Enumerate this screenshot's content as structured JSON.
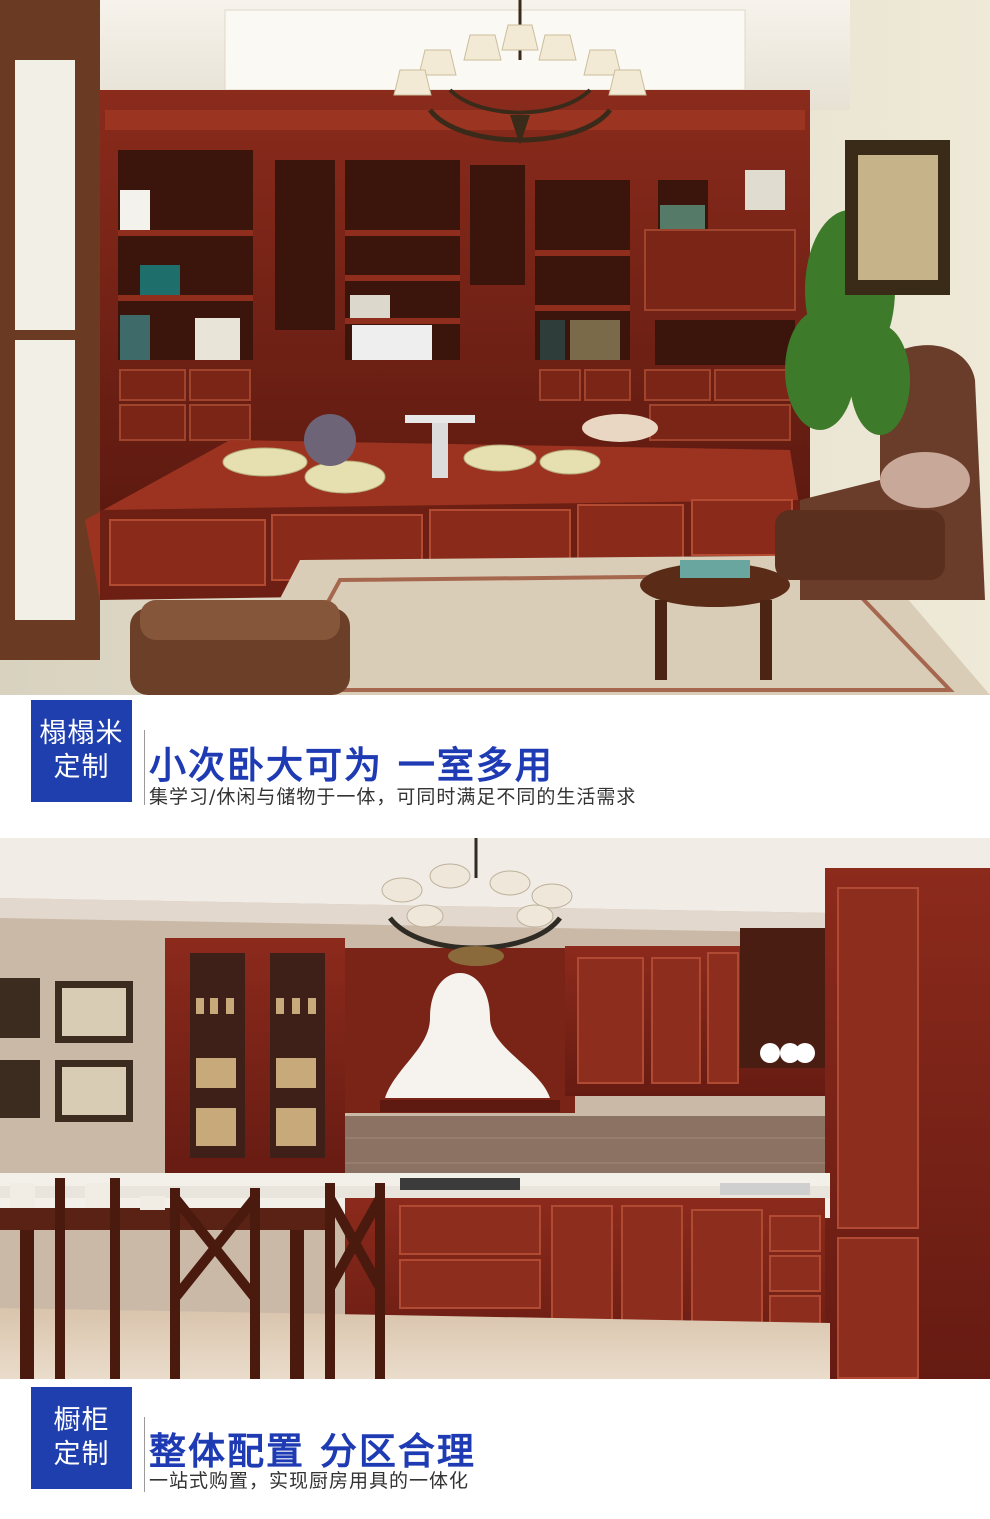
{
  "sections": [
    {
      "badge_line1": "榻榻米",
      "badge_line2": "定制",
      "headline": "小次卧大可为 一室多用",
      "subline": "集学习/休闲与储物于一体，可同时满足不同的生活需求"
    },
    {
      "badge_line1": "橱柜",
      "badge_line2": "定制",
      "headline": "整体配置 分区合理",
      "subline": "一站式购置，实现厨房用具的一体化"
    }
  ],
  "colors": {
    "badge": "#1f3fae",
    "headline": "#1e3bb3",
    "cabinet_wood": "#7a2418",
    "wall_cream": "#e9e2cf",
    "wall_taupe": "#c9b9a6"
  }
}
